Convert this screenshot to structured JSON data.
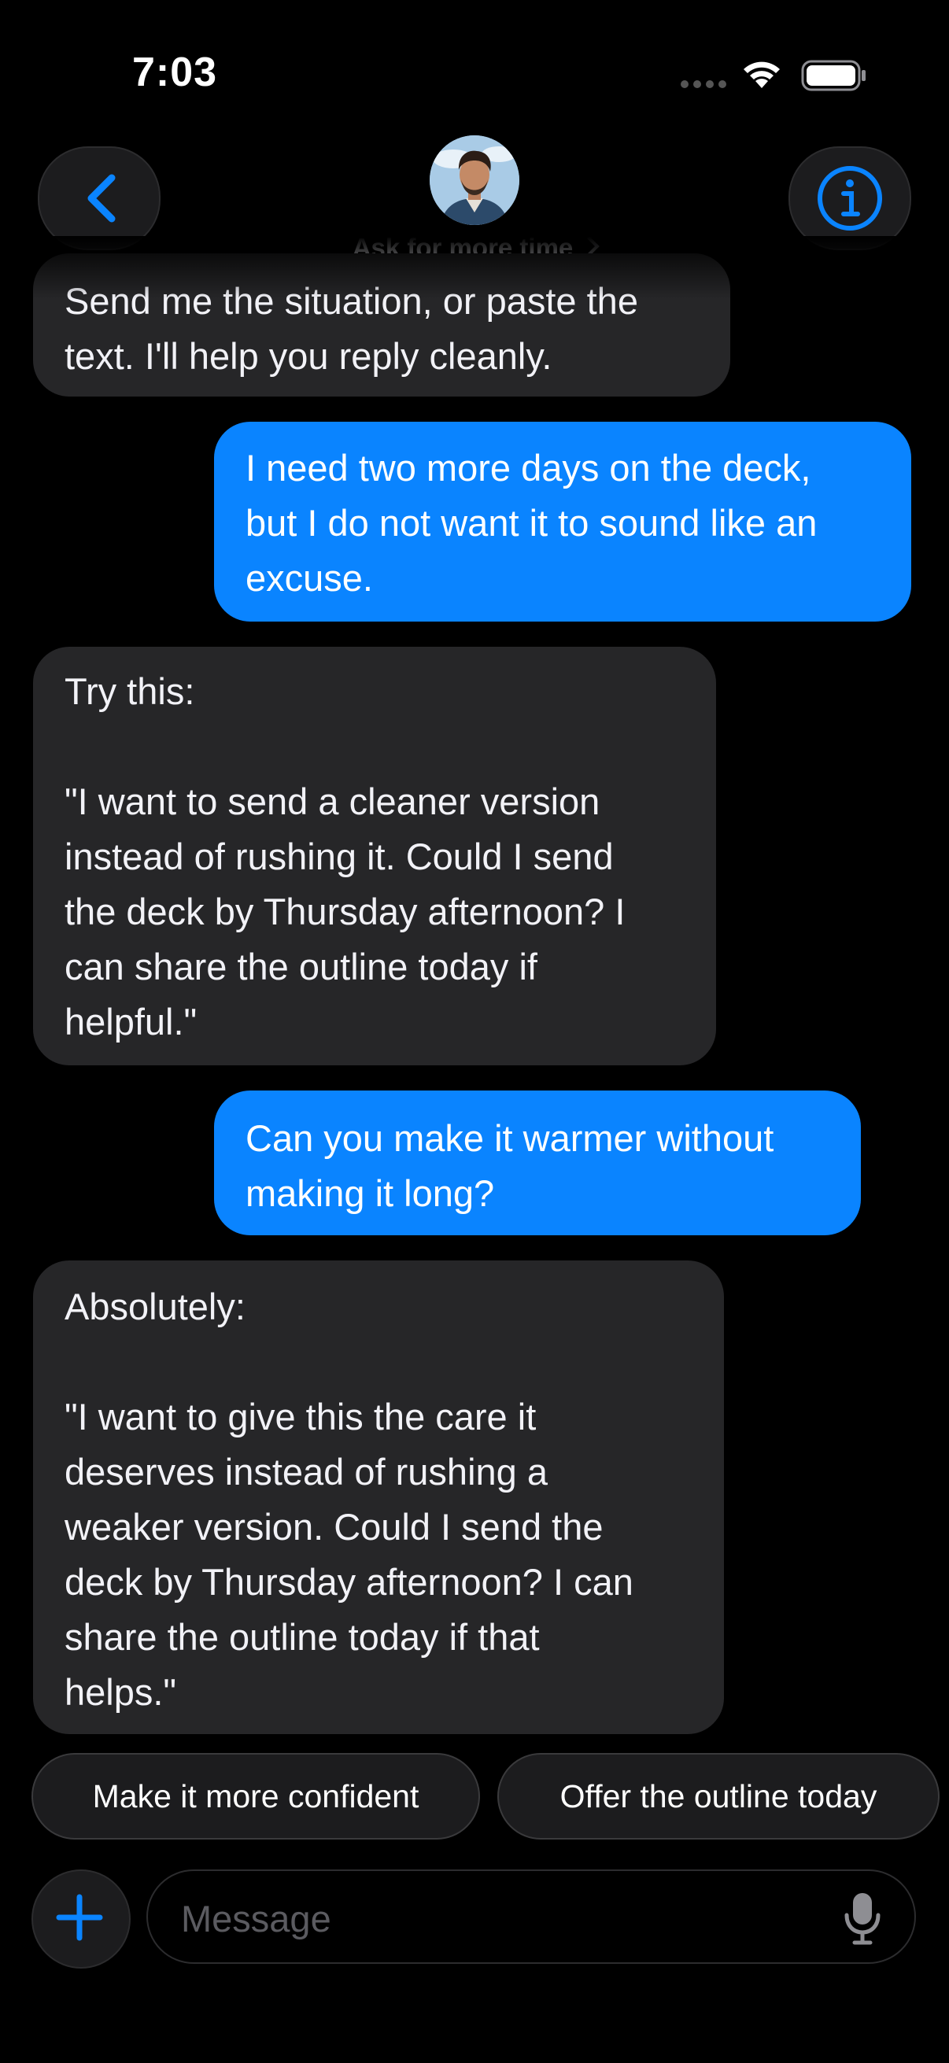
{
  "status_bar": {
    "time": "7:03"
  },
  "header": {
    "contact_name": "Ask for more time"
  },
  "messages": [
    {
      "from": "assistant",
      "text": "Send me the situation, or paste the\ntext. I'll help you reply cleanly."
    },
    {
      "from": "user",
      "text": "I need two more days on the deck,\nbut I do not want it to sound like an\nexcuse."
    },
    {
      "from": "assistant",
      "text": "Try this:\n\n\"I want to send a cleaner version\ninstead of rushing it. Could I send\nthe deck by Thursday afternoon? I\ncan share the outline today if\nhelpful.\""
    },
    {
      "from": "user",
      "text": "Can you make it warmer without\nmaking it long?"
    },
    {
      "from": "assistant",
      "text": "Absolutely:\n\n\"I want to give this the care it\ndeserves instead of rushing a\nweaker version. Could I send the\ndeck by Thursday afternoon? I can\nshare the outline today if that\nhelps.\""
    }
  ],
  "suggestions": [
    "Make it more confident",
    "Offer the outline today"
  ],
  "composer": {
    "placeholder": "Message"
  },
  "colors": {
    "accent": "#0a84ff",
    "incoming_bubble": "#262628",
    "background": "#000000"
  },
  "icons": {
    "back": "chevron-left-icon",
    "info": "info-icon",
    "add": "plus-icon",
    "mic": "microphone-icon"
  }
}
